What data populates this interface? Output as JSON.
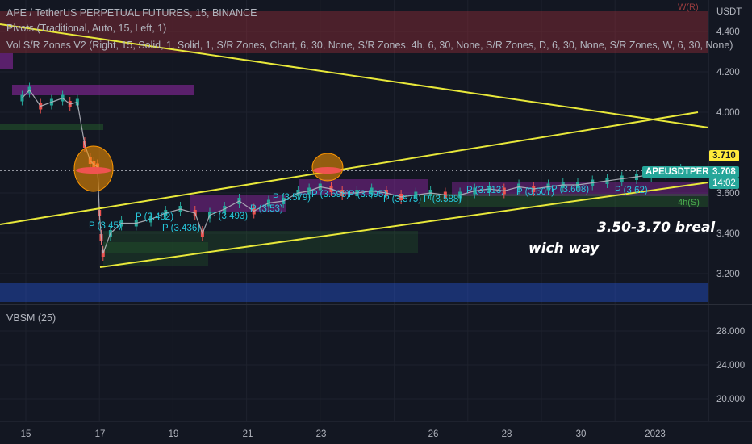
{
  "header": {
    "title": "APE / TetherUS PERPETUAL FUTURES, 15, BINANCE",
    "pivots_indicator": "Pivots (Traditional, Auto, 15, Left, 1)",
    "vol_indicator": "Vol S/R Zones V2 (Right, 15, Solid, 1, Solid, 1, S/R Zones, Chart, 6, 30, None, S/R Zones, 4h, 6, 30, None, S/R Zones, D, 6, 30, None, S/R Zones, W, 6, 30, None)",
    "sub_indicator": "VBSM (25)",
    "currency": "USDT"
  },
  "colors": {
    "background": "#131722",
    "grid": "#1e222d",
    "up": "#26a69a",
    "down": "#ef5350",
    "yellow_line": "#e8e83a",
    "pivot_text": "#26c6da",
    "last_price": "#26a69a",
    "alert_price": "#ffeb3b"
  },
  "annotations": {
    "range_note": "3.50-3.70 breal",
    "direction_note": "wich way"
  },
  "price_tags": {
    "alert_value": "3.710",
    "symbol_label": "APEUSDTPERP",
    "last_value": "3.708",
    "countdown": "14:02"
  },
  "zone_labels": {
    "weekly_resistance": "W(R)",
    "h4_support": "4h(S)"
  },
  "chart_data": {
    "type": "line",
    "title": "APE / TetherUS PERPETUAL FUTURES, 15, BINANCE",
    "xlabel": "",
    "ylabel": "",
    "x_ticks": [
      "15",
      "17",
      "19",
      "21",
      "23",
      "26",
      "28",
      "30",
      "2023"
    ],
    "y_ticks": [
      "4.400",
      "4.200",
      "4.000",
      "3.600",
      "3.400",
      "3.200"
    ],
    "ylim": [
      3.07,
      4.5
    ],
    "sub_y_ticks": [
      "28.000",
      "24.000",
      "20.000"
    ],
    "grid": true,
    "series": [
      {
        "name": "",
        "x": [
          14.9,
          15.1,
          15.4,
          15.7,
          16.0,
          16.2,
          16.4,
          16.6,
          16.75,
          16.85,
          16.95,
          17.0,
          17.05,
          17.1,
          17.3,
          17.6,
          18.0,
          18.4,
          18.8,
          19.2,
          19.6,
          19.8,
          20.0,
          20.4,
          20.8,
          21.2,
          21.6,
          22.0,
          22.4,
          22.7,
          23.0,
          23.3,
          23.6,
          24.0,
          24.4,
          24.8,
          25.2,
          25.6,
          26.0,
          26.4,
          26.8,
          27.2,
          27.6,
          28.0,
          28.4,
          28.8,
          29.2,
          29.6,
          30.0,
          30.4,
          30.8,
          31.2,
          31.6,
          32.0,
          32.4,
          32.8
        ],
        "y": [
          4.07,
          4.11,
          4.03,
          4.05,
          4.07,
          4.04,
          4.05,
          3.84,
          3.76,
          3.74,
          3.73,
          3.5,
          3.38,
          3.3,
          3.4,
          3.45,
          3.45,
          3.47,
          3.5,
          3.52,
          3.5,
          3.4,
          3.49,
          3.52,
          3.56,
          3.51,
          3.55,
          3.56,
          3.6,
          3.61,
          3.63,
          3.62,
          3.6,
          3.6,
          3.61,
          3.6,
          3.58,
          3.59,
          3.6,
          3.59,
          3.59,
          3.61,
          3.62,
          3.61,
          3.63,
          3.62,
          3.63,
          3.64,
          3.64,
          3.65,
          3.66,
          3.67,
          3.68,
          3.69,
          3.7,
          3.708
        ]
      }
    ],
    "pivot_labels": [
      "P (3.45)",
      "P (3.482)",
      "P (3.493)",
      "P (3.436)",
      "P (3.53)",
      "P (3.579)",
      "P (3.598)",
      "P (3.595)",
      "P (3.575)",
      "P (3.588)",
      "P (3.613)",
      "P (3.607)",
      "P (3.608)",
      "P (3.62)"
    ]
  }
}
